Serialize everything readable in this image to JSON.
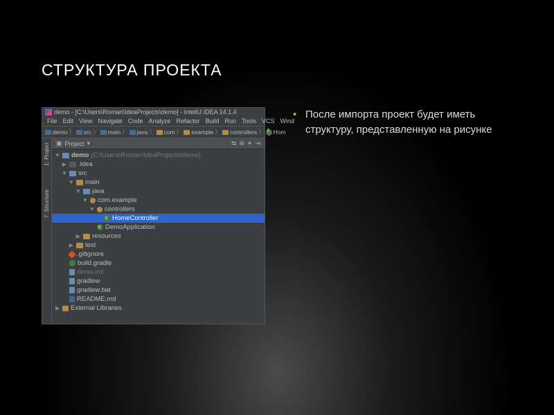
{
  "slide": {
    "title": "СТРУКТУРА ПРОЕКТА",
    "bullet": "После импорта проект будет иметь структуру, представленную на рисунке"
  },
  "ide": {
    "title": "demo - [C:\\Users\\Roman\\IdeaProjects\\demo] - IntelliJ IDEA 14.1.4",
    "menu": [
      "File",
      "Edit",
      "View",
      "Navigate",
      "Code",
      "Analyze",
      "Refactor",
      "Build",
      "Run",
      "Tools",
      "VCS",
      "Wind"
    ],
    "breadcrumb": [
      "demo",
      "src",
      "main",
      "java",
      "com",
      "example",
      "controllers",
      "Hom"
    ],
    "panel_label": "Project",
    "gutter": {
      "project": "1: Project",
      "structure": "7: Structure"
    },
    "tree": {
      "root": "demo",
      "root_path": "(C:\\Users\\Roman\\IdeaProjects\\demo)",
      "idea": ".idea",
      "src": "src",
      "main": "main",
      "java": "java",
      "pkg": "com.example",
      "controllers": "controllers",
      "home_ctrl": "HomeController",
      "demo_app": "DemoApplication",
      "resources": "resources",
      "test": "test",
      "gitignore": ".gitignore",
      "build_gradle": "build.gradle",
      "demo_iml": "demo.iml",
      "gradlew": "gradlew",
      "gradlew_bat": "gradlew.bat",
      "readme": "README.md",
      "ext_lib": "External Libraries"
    }
  }
}
